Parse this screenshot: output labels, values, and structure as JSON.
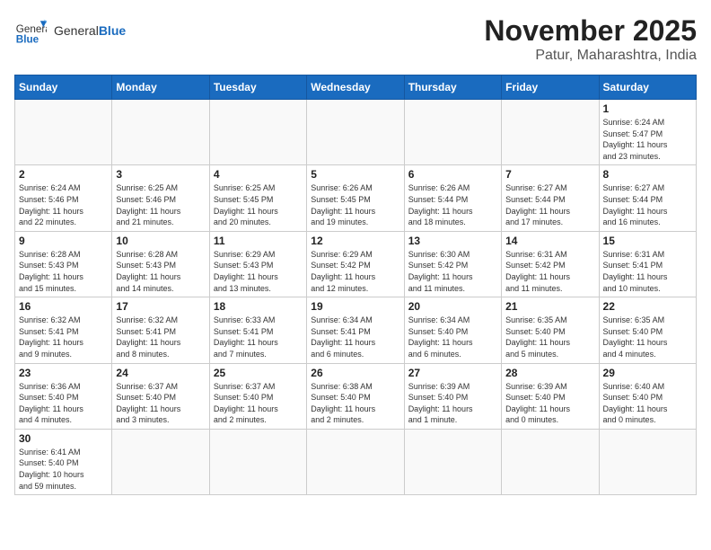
{
  "header": {
    "logo_general": "General",
    "logo_blue": "Blue",
    "month": "November 2025",
    "location": "Patur, Maharashtra, India"
  },
  "weekdays": [
    "Sunday",
    "Monday",
    "Tuesday",
    "Wednesday",
    "Thursday",
    "Friday",
    "Saturday"
  ],
  "days": [
    {
      "date": "",
      "info": ""
    },
    {
      "date": "",
      "info": ""
    },
    {
      "date": "",
      "info": ""
    },
    {
      "date": "",
      "info": ""
    },
    {
      "date": "",
      "info": ""
    },
    {
      "date": "",
      "info": ""
    },
    {
      "date": "1",
      "info": "Sunrise: 6:24 AM\nSunset: 5:47 PM\nDaylight: 11 hours\nand 23 minutes."
    },
    {
      "date": "2",
      "info": "Sunrise: 6:24 AM\nSunset: 5:46 PM\nDaylight: 11 hours\nand 22 minutes."
    },
    {
      "date": "3",
      "info": "Sunrise: 6:25 AM\nSunset: 5:46 PM\nDaylight: 11 hours\nand 21 minutes."
    },
    {
      "date": "4",
      "info": "Sunrise: 6:25 AM\nSunset: 5:45 PM\nDaylight: 11 hours\nand 20 minutes."
    },
    {
      "date": "5",
      "info": "Sunrise: 6:26 AM\nSunset: 5:45 PM\nDaylight: 11 hours\nand 19 minutes."
    },
    {
      "date": "6",
      "info": "Sunrise: 6:26 AM\nSunset: 5:44 PM\nDaylight: 11 hours\nand 18 minutes."
    },
    {
      "date": "7",
      "info": "Sunrise: 6:27 AM\nSunset: 5:44 PM\nDaylight: 11 hours\nand 17 minutes."
    },
    {
      "date": "8",
      "info": "Sunrise: 6:27 AM\nSunset: 5:44 PM\nDaylight: 11 hours\nand 16 minutes."
    },
    {
      "date": "9",
      "info": "Sunrise: 6:28 AM\nSunset: 5:43 PM\nDaylight: 11 hours\nand 15 minutes."
    },
    {
      "date": "10",
      "info": "Sunrise: 6:28 AM\nSunset: 5:43 PM\nDaylight: 11 hours\nand 14 minutes."
    },
    {
      "date": "11",
      "info": "Sunrise: 6:29 AM\nSunset: 5:43 PM\nDaylight: 11 hours\nand 13 minutes."
    },
    {
      "date": "12",
      "info": "Sunrise: 6:29 AM\nSunset: 5:42 PM\nDaylight: 11 hours\nand 12 minutes."
    },
    {
      "date": "13",
      "info": "Sunrise: 6:30 AM\nSunset: 5:42 PM\nDaylight: 11 hours\nand 11 minutes."
    },
    {
      "date": "14",
      "info": "Sunrise: 6:31 AM\nSunset: 5:42 PM\nDaylight: 11 hours\nand 11 minutes."
    },
    {
      "date": "15",
      "info": "Sunrise: 6:31 AM\nSunset: 5:41 PM\nDaylight: 11 hours\nand 10 minutes."
    },
    {
      "date": "16",
      "info": "Sunrise: 6:32 AM\nSunset: 5:41 PM\nDaylight: 11 hours\nand 9 minutes."
    },
    {
      "date": "17",
      "info": "Sunrise: 6:32 AM\nSunset: 5:41 PM\nDaylight: 11 hours\nand 8 minutes."
    },
    {
      "date": "18",
      "info": "Sunrise: 6:33 AM\nSunset: 5:41 PM\nDaylight: 11 hours\nand 7 minutes."
    },
    {
      "date": "19",
      "info": "Sunrise: 6:34 AM\nSunset: 5:41 PM\nDaylight: 11 hours\nand 6 minutes."
    },
    {
      "date": "20",
      "info": "Sunrise: 6:34 AM\nSunset: 5:40 PM\nDaylight: 11 hours\nand 6 minutes."
    },
    {
      "date": "21",
      "info": "Sunrise: 6:35 AM\nSunset: 5:40 PM\nDaylight: 11 hours\nand 5 minutes."
    },
    {
      "date": "22",
      "info": "Sunrise: 6:35 AM\nSunset: 5:40 PM\nDaylight: 11 hours\nand 4 minutes."
    },
    {
      "date": "23",
      "info": "Sunrise: 6:36 AM\nSunset: 5:40 PM\nDaylight: 11 hours\nand 4 minutes."
    },
    {
      "date": "24",
      "info": "Sunrise: 6:37 AM\nSunset: 5:40 PM\nDaylight: 11 hours\nand 3 minutes."
    },
    {
      "date": "25",
      "info": "Sunrise: 6:37 AM\nSunset: 5:40 PM\nDaylight: 11 hours\nand 2 minutes."
    },
    {
      "date": "26",
      "info": "Sunrise: 6:38 AM\nSunset: 5:40 PM\nDaylight: 11 hours\nand 2 minutes."
    },
    {
      "date": "27",
      "info": "Sunrise: 6:39 AM\nSunset: 5:40 PM\nDaylight: 11 hours\nand 1 minute."
    },
    {
      "date": "28",
      "info": "Sunrise: 6:39 AM\nSunset: 5:40 PM\nDaylight: 11 hours\nand 0 minutes."
    },
    {
      "date": "29",
      "info": "Sunrise: 6:40 AM\nSunset: 5:40 PM\nDaylight: 11 hours\nand 0 minutes."
    },
    {
      "date": "30",
      "info": "Sunrise: 6:41 AM\nSunset: 5:40 PM\nDaylight: 10 hours\nand 59 minutes."
    },
    {
      "date": "",
      "info": ""
    },
    {
      "date": "",
      "info": ""
    },
    {
      "date": "",
      "info": ""
    },
    {
      "date": "",
      "info": ""
    },
    {
      "date": "",
      "info": ""
    },
    {
      "date": "",
      "info": ""
    }
  ]
}
